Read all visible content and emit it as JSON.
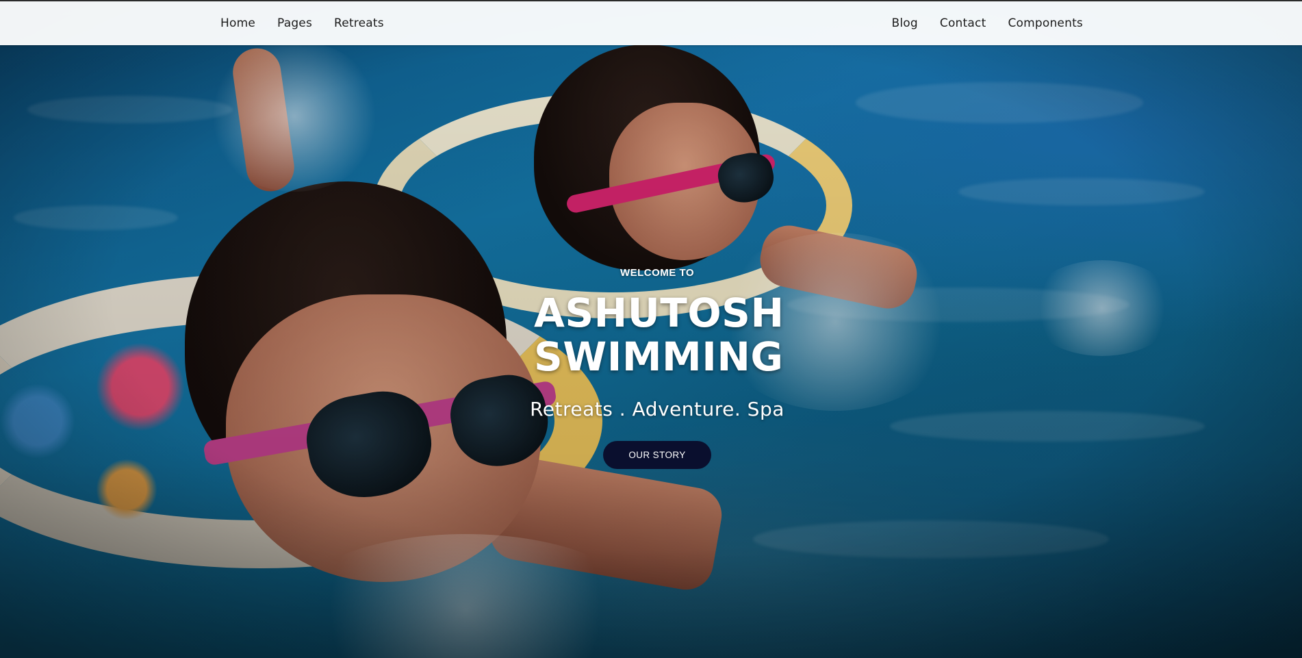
{
  "nav": {
    "left": [
      {
        "label": "Home"
      },
      {
        "label": "Pages"
      },
      {
        "label": "Retreats"
      }
    ],
    "right": [
      {
        "label": "Blog"
      },
      {
        "label": "Contact"
      },
      {
        "label": "Components"
      }
    ]
  },
  "hero": {
    "eyebrow": "WELCOME TO",
    "title": "ASHUTOSH SWIMMING",
    "subtitle": "Retreats . Adventure. Spa",
    "cta_label": "OUR STORY",
    "background_image": "children-swimming-in-pool-photo"
  },
  "colors": {
    "nav_background": "#ffffff",
    "cta_background": "#0a0f2e",
    "hero_text": "#ffffff"
  }
}
